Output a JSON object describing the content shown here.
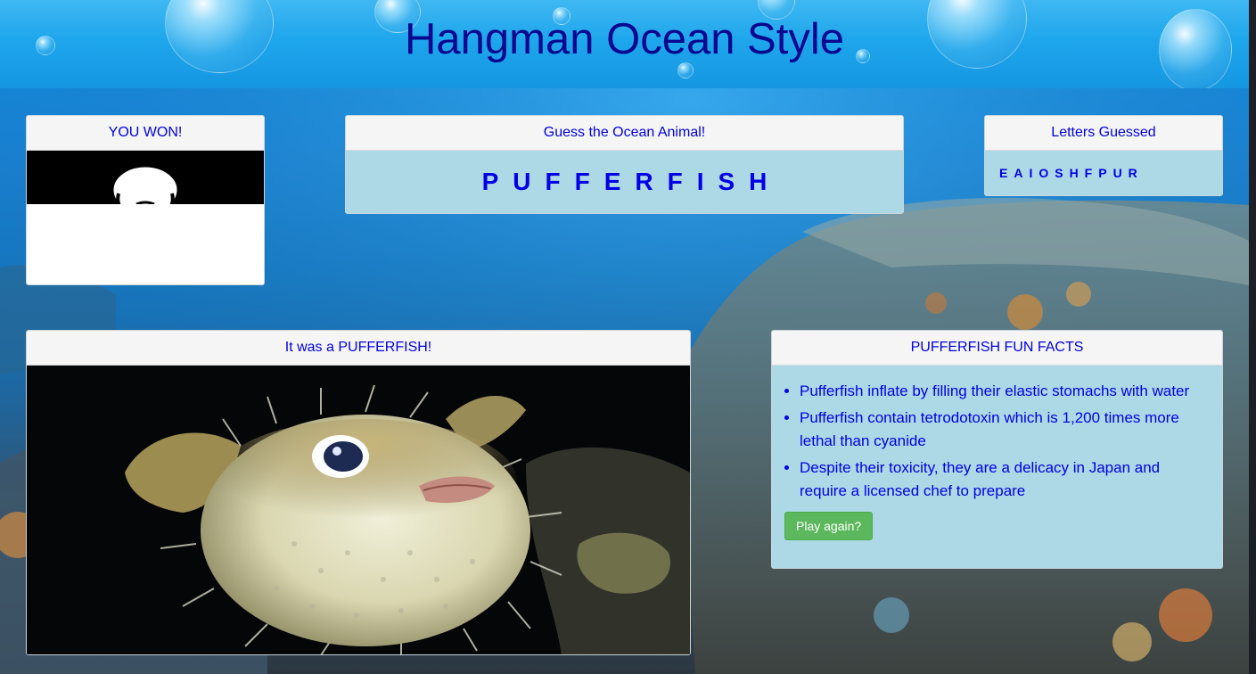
{
  "header": {
    "title": "Hangman Ocean Style"
  },
  "status_card": {
    "title": "YOU WON!"
  },
  "word_card": {
    "title": "Guess the Ocean Animal!",
    "word": "PUFFERFISH"
  },
  "letters_card": {
    "title": "Letters Guessed",
    "letters": "EAIOSHFPUR"
  },
  "reveal_card": {
    "title": "It was a PUFFERFISH!"
  },
  "facts_card": {
    "title": "PUFFERFISH FUN FACTS",
    "facts": [
      "Pufferfish inflate by filling their elastic stomachs with water",
      "Pufferfish contain tetrodotoxin which is 1,200 times more lethal than cyanide",
      "Despite their toxicity, they are a delicacy in Japan and require a licensed chef to prepare"
    ],
    "play_again_label": "Play again?"
  },
  "colors": {
    "text_accent": "#0000e6",
    "title_color": "#07078f",
    "card_body": "#add8e6",
    "button": "#5cb85c"
  }
}
